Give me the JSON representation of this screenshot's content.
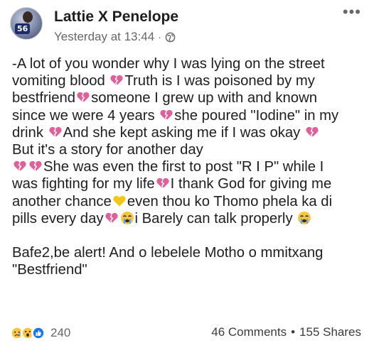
{
  "post": {
    "author": "Lattie X Penelope",
    "timestamp": "Yesterday at 13:44",
    "separator": "·",
    "privacy_icon": "globe-icon",
    "avatar_badge": "56",
    "more_icon": "more-options-icon",
    "body_lines": [
      [
        "-A lot of you wonder why I was lying on the street"
      ],
      [
        "vomiting blood ",
        "heart",
        "Truth is I was poisoned by my"
      ],
      [
        "bestfriend",
        "heart",
        "someone I grew up with and known"
      ],
      [
        "since we were 4 years ",
        "heart",
        "she poured \"Iodine\" in my"
      ],
      [
        "drink ",
        "heart",
        "And she kept asking me if I was okay ",
        "heart"
      ],
      [
        "But it's a story for another day"
      ],
      [
        "heart",
        "heart",
        "She was even the first to post \"R I P\" while I"
      ],
      [
        "was fighting for my life",
        "heart",
        "I thank God for giving me"
      ],
      [
        "another chance",
        "yellowheart",
        "even thou ko Thomo phela ka di"
      ],
      [
        "pills every day",
        "heart",
        "cry",
        "i Barely can talk properly ",
        "cry"
      ],
      [],
      [
        "Bafe2,be alert! And o lebelele Motho o mmitxang"
      ],
      [
        "\"Bestfriend\""
      ]
    ]
  },
  "reactions": {
    "icons": [
      "sad-reaction-icon",
      "wow-reaction-icon",
      "like-reaction-icon"
    ],
    "count": "240"
  },
  "stats": {
    "comments": "46 Comments",
    "separator": "•",
    "shares": "155 Shares"
  },
  "colors": {
    "broken_heart": "#e0609a",
    "yellow_heart": "#f5c518",
    "meta_text": "#65676b",
    "like_blue": "#1877f2"
  }
}
